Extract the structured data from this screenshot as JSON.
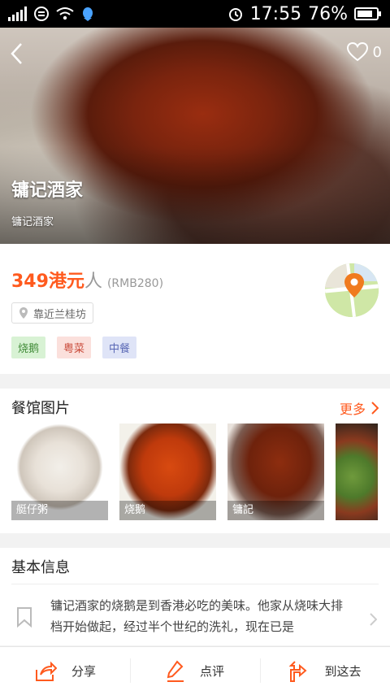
{
  "status_bar": {
    "time": "17:55",
    "battery": "76%"
  },
  "hero": {
    "title": "镛记酒家",
    "subtitle": "镛记酒家",
    "favorite_count": "0"
  },
  "info": {
    "price": "349",
    "currency": "港元",
    "per": "人",
    "rmb": "(RMB280)",
    "location": "靠近兰桂坊",
    "tags": [
      {
        "label": "烧鹅",
        "color": "#3f8a36"
      },
      {
        "label": "粤菜",
        "color": "#c94b3b"
      },
      {
        "label": "中餐",
        "color": "#5a68b5"
      }
    ]
  },
  "photos": {
    "title": "餐馆图片",
    "more": "更多",
    "items": [
      {
        "caption": "艇仔粥"
      },
      {
        "caption": "烧鹅"
      },
      {
        "caption": "镛記"
      },
      {
        "caption": ""
      }
    ]
  },
  "basic_info": {
    "title": "基本信息",
    "description": "镛记酒家的烧鹅是到香港必吃的美味。他家从烧味大排档开始做起，经过半个世纪的洗礼，现在已是"
  },
  "bottom_bar": {
    "share": "分享",
    "review": "点评",
    "go": "到这去"
  },
  "colors": {
    "accent": "#ff5a1e",
    "map_pin": "#f07b1f"
  }
}
